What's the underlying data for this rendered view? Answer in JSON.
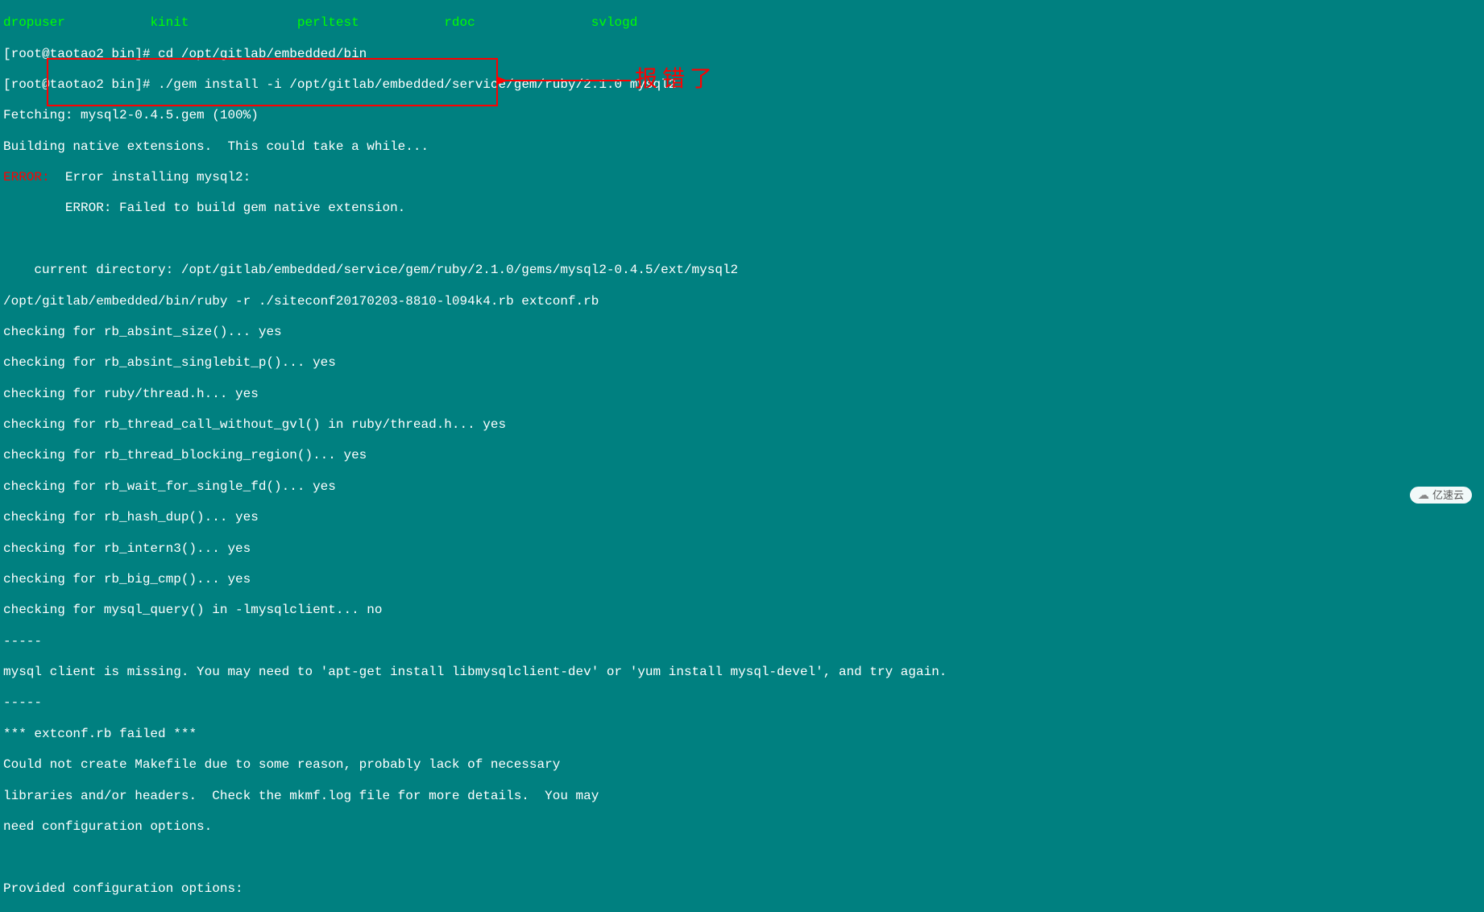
{
  "colors": {
    "background": "#008080",
    "text": "#ffffff",
    "highlight_green": "#00ff00",
    "error_red": "#ff0000"
  },
  "top_fragments": {
    "frag1": "dropuser",
    "frag2": "kinit",
    "frag3": "perltest",
    "frag4": "rdoc",
    "frag5": "svlogd"
  },
  "prompt": {
    "user_host": "[root@taotao2 bin]#",
    "cmd1": " cd /opt/gitlab/embedded/bin",
    "cmd2": " ./gem install -i /opt/gitlab/embedded/service/gem/ruby/2.1.0 mysql2"
  },
  "lines": {
    "fetch": "Fetching: mysql2-0.4.5.gem (100%)",
    "building": "Building native extensions.  This could take a while...",
    "err_prefix": "ERROR:",
    "err_line1": "  Error installing mysql2:",
    "err_line2": "\tERROR: Failed to build gem native extension.",
    "blank": "",
    "curdir": "    current directory: /opt/gitlab/embedded/service/gem/ruby/2.1.0/gems/mysql2-0.4.5/ext/mysql2",
    "ruby": "/opt/gitlab/embedded/bin/ruby -r ./siteconf20170203-8810-l094k4.rb extconf.rb",
    "chk1": "checking for rb_absint_size()... yes",
    "chk2": "checking for rb_absint_singlebit_p()... yes",
    "chk3": "checking for ruby/thread.h... yes",
    "chk4": "checking for rb_thread_call_without_gvl() in ruby/thread.h... yes",
    "chk5": "checking for rb_thread_blocking_region()... yes",
    "chk6": "checking for rb_wait_for_single_fd()... yes",
    "chk7": "checking for rb_hash_dup()... yes",
    "chk8": "checking for rb_intern3()... yes",
    "chk9": "checking for rb_big_cmp()... yes",
    "chk10": "checking for mysql_query() in -lmysqlclient... no",
    "dash": "-----",
    "missing": "mysql client is missing. You may need to 'apt-get install libmysqlclient-dev' or 'yum install mysql-devel', and try again.",
    "extconf_fail": "*** extconf.rb failed ***",
    "could_not": "Could not create Makefile due to some reason, probably lack of necessary",
    "libraries": "libraries and/or headers.  Check the mkmf.log file for more details.  You may",
    "needconf": "need configuration options.",
    "provided": "Provided configuration options:"
  },
  "annotation": {
    "text": "报错了"
  },
  "watermark": {
    "icon": "☁",
    "text": "亿速云"
  }
}
